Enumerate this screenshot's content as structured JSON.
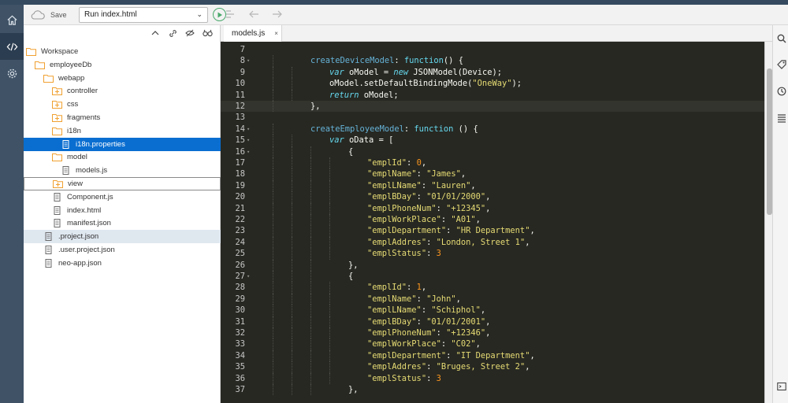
{
  "toolbar": {
    "save_label": "Save",
    "run_config": "Run index.html"
  },
  "icons": {
    "home": "home-icon",
    "code": "code-icon",
    "settings": "gear-icon",
    "cloud_save": "cloud-save-icon",
    "play": "play-icon"
  },
  "colors": {
    "selection": "#0a6ed1",
    "editor_bg": "#272822",
    "run_green": "#4aa96c"
  },
  "tree": {
    "items": [
      {
        "label": "Workspace",
        "type": "folder",
        "level": 0
      },
      {
        "label": "employeeDb",
        "type": "folder",
        "level": 1
      },
      {
        "label": "webapp",
        "type": "folder",
        "level": 2
      },
      {
        "label": "controller",
        "type": "folder-plus",
        "level": 3
      },
      {
        "label": "css",
        "type": "folder-plus",
        "level": 3
      },
      {
        "label": "fragments",
        "type": "folder-plus",
        "level": 3
      },
      {
        "label": "i18n",
        "type": "folder",
        "level": 3
      },
      {
        "label": "i18n.properties",
        "type": "file",
        "level": 4,
        "state": "selected"
      },
      {
        "label": "model",
        "type": "folder",
        "level": 3
      },
      {
        "label": "models.js",
        "type": "file",
        "level": 4
      },
      {
        "label": "view",
        "type": "folder-plus",
        "level": 3,
        "state": "outlined"
      },
      {
        "label": "Component.js",
        "type": "file",
        "level": 3
      },
      {
        "label": "index.html",
        "type": "file",
        "level": 3
      },
      {
        "label": "manifest.json",
        "type": "file",
        "level": 3
      },
      {
        "label": ".project.json",
        "type": "file",
        "level": 2,
        "state": "hover"
      },
      {
        "label": ".user.project.json",
        "type": "file",
        "level": 2
      },
      {
        "label": "neo-app.json",
        "type": "file",
        "level": 2
      }
    ]
  },
  "editor": {
    "tab_label": "models.js",
    "tab_close": "×",
    "active_line": 12,
    "lines": [
      {
        "n": "7",
        "fold": false,
        "indent": 0,
        "tokens": []
      },
      {
        "n": "8",
        "fold": true,
        "indent": 1,
        "tokens": [
          [
            "m-name",
            "createDeviceModel"
          ],
          [
            "m-plain",
            ": "
          ],
          [
            "m-func",
            "function"
          ],
          [
            "m-plain",
            "() {"
          ]
        ]
      },
      {
        "n": "9",
        "fold": false,
        "indent": 2,
        "tokens": [
          [
            "tk-kw",
            "var"
          ],
          [
            "m-plain",
            " oModel = "
          ],
          [
            "tk-kw",
            "new"
          ],
          [
            "m-plain",
            " JSONModel(Device);"
          ]
        ]
      },
      {
        "n": "10",
        "fold": false,
        "indent": 2,
        "tokens": [
          [
            "m-plain",
            "oModel.setDefaultBindingMode("
          ],
          [
            "str-val",
            "\"OneWay\""
          ],
          [
            "m-plain",
            ");"
          ]
        ]
      },
      {
        "n": "11",
        "fold": false,
        "indent": 2,
        "tokens": [
          [
            "tk-kw",
            "return"
          ],
          [
            "m-plain",
            " oModel;"
          ]
        ]
      },
      {
        "n": "12",
        "fold": false,
        "indent": 1,
        "tokens": [
          [
            "m-plain",
            "},"
          ]
        ]
      },
      {
        "n": "13",
        "fold": false,
        "indent": 0,
        "tokens": []
      },
      {
        "n": "14",
        "fold": true,
        "indent": 1,
        "tokens": [
          [
            "m-name",
            "createEmployeeModel"
          ],
          [
            "m-plain",
            ": "
          ],
          [
            "m-func",
            "function"
          ],
          [
            "m-plain",
            " () {"
          ]
        ]
      },
      {
        "n": "15",
        "fold": true,
        "indent": 2,
        "tokens": [
          [
            "tk-kw",
            "var"
          ],
          [
            "m-plain",
            " oData = ["
          ]
        ]
      },
      {
        "n": "16",
        "fold": true,
        "indent": 3,
        "tokens": [
          [
            "m-plain",
            "{"
          ]
        ]
      },
      {
        "n": "17",
        "fold": false,
        "indent": 4,
        "tokens": [
          [
            "str-val",
            "\"emplId\""
          ],
          [
            "m-plain",
            ": "
          ],
          [
            "num-val",
            "0"
          ],
          [
            "m-plain",
            ","
          ]
        ]
      },
      {
        "n": "18",
        "fold": false,
        "indent": 4,
        "tokens": [
          [
            "str-val",
            "\"emplName\""
          ],
          [
            "m-plain",
            ": "
          ],
          [
            "str-val",
            "\"James\""
          ],
          [
            "m-plain",
            ","
          ]
        ]
      },
      {
        "n": "19",
        "fold": false,
        "indent": 4,
        "tokens": [
          [
            "str-val",
            "\"emplLName\""
          ],
          [
            "m-plain",
            ": "
          ],
          [
            "str-val",
            "\"Lauren\""
          ],
          [
            "m-plain",
            ","
          ]
        ]
      },
      {
        "n": "20",
        "fold": false,
        "indent": 4,
        "tokens": [
          [
            "str-val",
            "\"emplBDay\""
          ],
          [
            "m-plain",
            ": "
          ],
          [
            "str-val",
            "\"01/01/2000\""
          ],
          [
            "m-plain",
            ","
          ]
        ]
      },
      {
        "n": "21",
        "fold": false,
        "indent": 4,
        "tokens": [
          [
            "str-val",
            "\"emplPhoneNum\""
          ],
          [
            "m-plain",
            ": "
          ],
          [
            "str-val",
            "\"+12345\""
          ],
          [
            "m-plain",
            ","
          ]
        ]
      },
      {
        "n": "22",
        "fold": false,
        "indent": 4,
        "tokens": [
          [
            "str-val",
            "\"emplWorkPlace\""
          ],
          [
            "m-plain",
            ": "
          ],
          [
            "str-val",
            "\"A01\""
          ],
          [
            "m-plain",
            ","
          ]
        ]
      },
      {
        "n": "23",
        "fold": false,
        "indent": 4,
        "tokens": [
          [
            "str-val",
            "\"emplDepartment\""
          ],
          [
            "m-plain",
            ": "
          ],
          [
            "str-val",
            "\"HR Department\""
          ],
          [
            "m-plain",
            ","
          ]
        ]
      },
      {
        "n": "24",
        "fold": false,
        "indent": 4,
        "tokens": [
          [
            "str-val",
            "\"emplAddres\""
          ],
          [
            "m-plain",
            ": "
          ],
          [
            "str-val",
            "\"London, Street 1\""
          ],
          [
            "m-plain",
            ","
          ]
        ]
      },
      {
        "n": "25",
        "fold": false,
        "indent": 4,
        "tokens": [
          [
            "str-val",
            "\"emplStatus\""
          ],
          [
            "m-plain",
            ": "
          ],
          [
            "num-val",
            "3"
          ]
        ]
      },
      {
        "n": "26",
        "fold": false,
        "indent": 3,
        "tokens": [
          [
            "m-plain",
            "},"
          ]
        ]
      },
      {
        "n": "27",
        "fold": true,
        "indent": 3,
        "tokens": [
          [
            "m-plain",
            "{"
          ]
        ]
      },
      {
        "n": "28",
        "fold": false,
        "indent": 4,
        "tokens": [
          [
            "str-val",
            "\"emplId\""
          ],
          [
            "m-plain",
            ": "
          ],
          [
            "num-val",
            "1"
          ],
          [
            "m-plain",
            ","
          ]
        ]
      },
      {
        "n": "29",
        "fold": false,
        "indent": 4,
        "tokens": [
          [
            "str-val",
            "\"emplName\""
          ],
          [
            "m-plain",
            ": "
          ],
          [
            "str-val",
            "\"John\""
          ],
          [
            "m-plain",
            ","
          ]
        ]
      },
      {
        "n": "30",
        "fold": false,
        "indent": 4,
        "tokens": [
          [
            "str-val",
            "\"emplLName\""
          ],
          [
            "m-plain",
            ": "
          ],
          [
            "str-val",
            "\"Schiphol\""
          ],
          [
            "m-plain",
            ","
          ]
        ]
      },
      {
        "n": "31",
        "fold": false,
        "indent": 4,
        "tokens": [
          [
            "str-val",
            "\"emplBDay\""
          ],
          [
            "m-plain",
            ": "
          ],
          [
            "str-val",
            "\"01/01/2001\""
          ],
          [
            "m-plain",
            ","
          ]
        ]
      },
      {
        "n": "32",
        "fold": false,
        "indent": 4,
        "tokens": [
          [
            "str-val",
            "\"emplPhoneNum\""
          ],
          [
            "m-plain",
            ": "
          ],
          [
            "str-val",
            "\"+12346\""
          ],
          [
            "m-plain",
            ","
          ]
        ]
      },
      {
        "n": "33",
        "fold": false,
        "indent": 4,
        "tokens": [
          [
            "str-val",
            "\"emplWorkPlace\""
          ],
          [
            "m-plain",
            ": "
          ],
          [
            "str-val",
            "\"C02\""
          ],
          [
            "m-plain",
            ","
          ]
        ]
      },
      {
        "n": "34",
        "fold": false,
        "indent": 4,
        "tokens": [
          [
            "str-val",
            "\"emplDepartment\""
          ],
          [
            "m-plain",
            ": "
          ],
          [
            "str-val",
            "\"IT Department\""
          ],
          [
            "m-plain",
            ","
          ]
        ]
      },
      {
        "n": "35",
        "fold": false,
        "indent": 4,
        "tokens": [
          [
            "str-val",
            "\"emplAddres\""
          ],
          [
            "m-plain",
            ": "
          ],
          [
            "str-val",
            "\"Bruges, Street 2\""
          ],
          [
            "m-plain",
            ","
          ]
        ]
      },
      {
        "n": "36",
        "fold": false,
        "indent": 4,
        "tokens": [
          [
            "str-val",
            "\"emplStatus\""
          ],
          [
            "m-plain",
            ": "
          ],
          [
            "num-val",
            "3"
          ]
        ]
      },
      {
        "n": "37",
        "fold": false,
        "indent": 3,
        "tokens": [
          [
            "m-plain",
            "},"
          ]
        ]
      }
    ]
  }
}
